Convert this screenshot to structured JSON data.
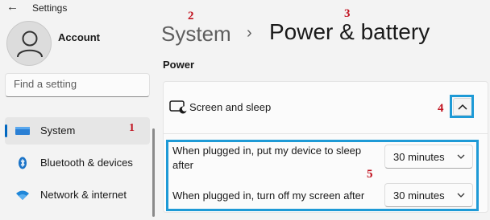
{
  "window": {
    "title": "Settings",
    "back_icon": "back-arrow-icon"
  },
  "account": {
    "name": "Account",
    "avatar_icon": "person-icon"
  },
  "search": {
    "placeholder": "Find a setting",
    "value": ""
  },
  "sidebar": {
    "items": [
      {
        "label": "System",
        "icon": "monitor-icon",
        "selected": true,
        "marker": "1"
      },
      {
        "label": "Bluetooth & devices",
        "icon": "bluetooth-icon",
        "selected": false
      },
      {
        "label": "Network & internet",
        "icon": "wifi-icon",
        "selected": false
      }
    ]
  },
  "breadcrumb": {
    "parent": "System",
    "separator": "›",
    "current": "Power & battery"
  },
  "section": {
    "title": "Power"
  },
  "screen_sleep": {
    "label": "Screen and sleep",
    "icon": "screen-sleep-icon",
    "expanded": true,
    "collapse_icon": "chevron-up-icon",
    "options": [
      {
        "label": "When plugged in, put my device to sleep after",
        "value": "30 minutes"
      },
      {
        "label": "When plugged in, turn off my screen after",
        "value": "30 minutes"
      }
    ]
  },
  "annotations": {
    "m1": "1",
    "m2": "2",
    "m3": "3",
    "m4": "4",
    "m5": "5"
  },
  "colors": {
    "accent": "#0067c0",
    "highlight": "#1e9ad6",
    "marker": "#c1121f"
  }
}
